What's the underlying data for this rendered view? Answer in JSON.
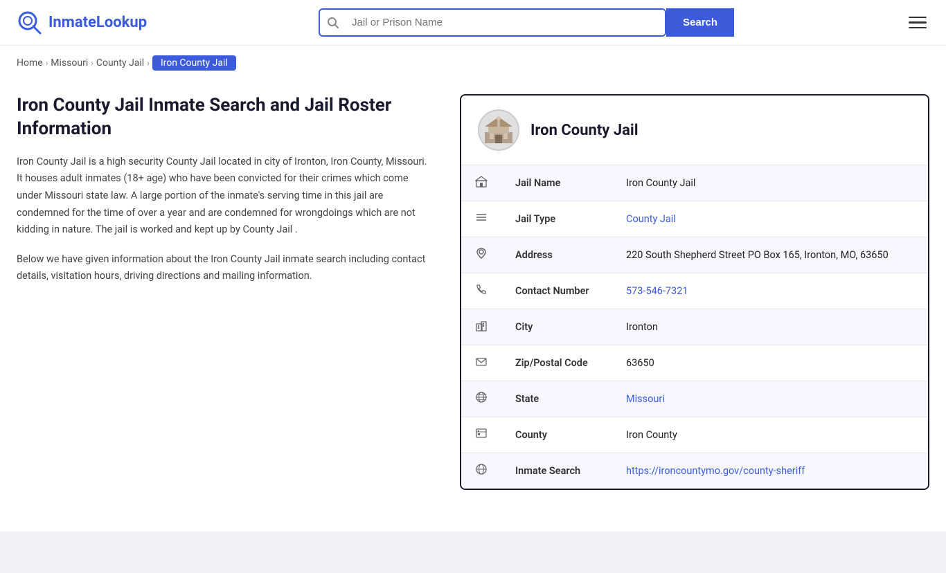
{
  "site": {
    "name_part1": "Inmate",
    "name_part2": "Lookup"
  },
  "header": {
    "search_placeholder": "Jail or Prison Name",
    "search_button_label": "Search"
  },
  "breadcrumb": {
    "items": [
      {
        "label": "Home",
        "href": "#"
      },
      {
        "label": "Missouri",
        "href": "#"
      },
      {
        "label": "County Jail",
        "href": "#"
      },
      {
        "label": "Iron County Jail",
        "active": true
      }
    ]
  },
  "main": {
    "page_title": "Iron County Jail Inmate Search and Jail Roster Information",
    "description1": "Iron County Jail is a high security County Jail located in city of Ironton, Iron County, Missouri. It houses adult inmates (18+ age) who have been convicted for their crimes which come under Missouri state law. A large portion of the inmate's serving time in this jail are condemned for the time of over a year and are condemned for wrongdoings which are not kidding in nature. The jail is worked and kept up by County Jail .",
    "description2": "Below we have given information about the Iron County Jail inmate search including contact details, visitation hours, driving directions and mailing information."
  },
  "info_card": {
    "title": "Iron County Jail",
    "rows": [
      {
        "icon": "building-icon",
        "label": "Jail Name",
        "value": "Iron County Jail",
        "link": null
      },
      {
        "icon": "list-icon",
        "label": "Jail Type",
        "value": "County Jail",
        "link": "#"
      },
      {
        "icon": "location-icon",
        "label": "Address",
        "value": "220 South Shepherd Street PO Box 165, Ironton, MO, 63650",
        "link": null
      },
      {
        "icon": "phone-icon",
        "label": "Contact Number",
        "value": "573-546-7321",
        "link": "tel:573-546-7321"
      },
      {
        "icon": "city-icon",
        "label": "City",
        "value": "Ironton",
        "link": null
      },
      {
        "icon": "mail-icon",
        "label": "Zip/Postal Code",
        "value": "63650",
        "link": null
      },
      {
        "icon": "globe-icon",
        "label": "State",
        "value": "Missouri",
        "link": "#"
      },
      {
        "icon": "county-icon",
        "label": "County",
        "value": "Iron County",
        "link": null
      },
      {
        "icon": "web-icon",
        "label": "Inmate Search",
        "value": "https://ironcountymo.gov/county-sheriff",
        "link": "https://ironcountymo.gov/county-sheriff"
      }
    ]
  }
}
